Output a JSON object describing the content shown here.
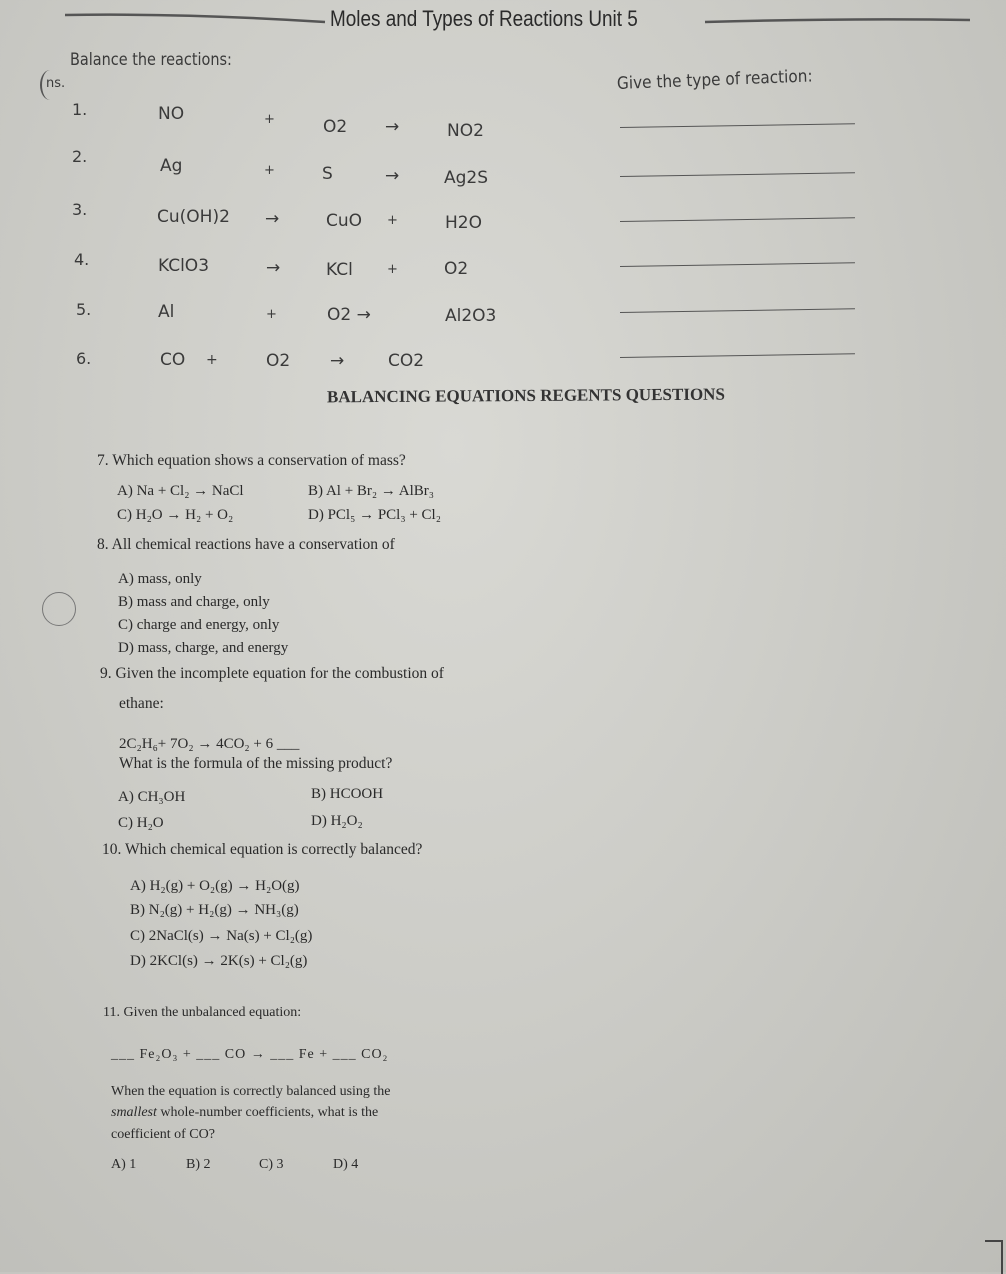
{
  "header": {
    "title": "Moles and Types of Reactions Unit 5",
    "instruction": "Balance the reactions:",
    "margin_note": "ns.",
    "type_prompt": "Give the type of reaction:"
  },
  "reactions": [
    {
      "num": "1.",
      "terms": [
        "NO",
        "+",
        "O2",
        "→",
        "NO2"
      ]
    },
    {
      "num": "2.",
      "terms": [
        "Ag",
        "+",
        "S",
        "→",
        "Ag2S"
      ]
    },
    {
      "num": "3.",
      "terms": [
        "Cu(OH)2",
        "→",
        "CuO",
        "+",
        "H2O"
      ]
    },
    {
      "num": "4.",
      "terms": [
        "KClO3",
        "→",
        "KCl",
        "+",
        "O2"
      ]
    },
    {
      "num": "5.",
      "terms": [
        "Al",
        "+",
        "O2 →",
        "Al2O3"
      ]
    },
    {
      "num": "6.",
      "terms": [
        "CO",
        "+",
        "O2",
        "→",
        "CO2"
      ]
    }
  ],
  "section_heading": "BALANCING EQUATIONS REGENTS QUESTIONS",
  "questions": {
    "q7": {
      "stem": "7. Which equation shows a conservation of mass?",
      "A": "A)",
      "A_eq": "Na + Cl₂ → NaCl",
      "B": "B)",
      "B_eq": "Al + Br₂ → AlBr₃",
      "C": "C)",
      "C_eq": "H₂O → H₂ + O₂",
      "D": "D)",
      "D_eq": "PCl₅ → PCl₃ + Cl₂"
    },
    "q8": {
      "stem": "8. All chemical reactions have a conservation of",
      "options": [
        "A)  mass, only",
        "B)  mass and charge, only",
        "C)  charge and energy, only",
        "D)  mass, charge, and energy"
      ]
    },
    "q9": {
      "stem_line1": "9. Given the incomplete equation for the combustion of",
      "stem_line2": "ethane:",
      "equation": "2C₂H₆+ 7O₂ → 4CO₂ + 6 ___",
      "question": "What is the formula of the missing product?",
      "A": "A)  CH₃OH",
      "B": "B)  HCOOH",
      "C": "C)  H₂O",
      "D": "D)  H₂O₂"
    },
    "q10": {
      "stem": "10. Which chemical equation is correctly balanced?",
      "options": [
        "A)  H₂(g) + O₂(g) → H₂O(g)",
        "B)  N₂(g) + H₂(g) → NH₃(g)",
        "C)  2NaCl(s) → Na(s) + Cl₂(g)",
        "D)  2KCl(s) → 2K(s) + Cl₂(g)"
      ]
    },
    "q11": {
      "stem": "11. Given the unbalanced equation:",
      "equation": "___ Fe₂O₃ + ___ CO → ___ Fe + ___ CO₂",
      "line1": "When the equation is correctly balanced using the",
      "line2_em": "smallest",
      "line2_rest": " whole-number coefficients, what is the",
      "line3": "coefficient of CO?",
      "A": "A) 1",
      "B": "B) 2",
      "C": "C) 3",
      "D": "D) 4"
    }
  }
}
